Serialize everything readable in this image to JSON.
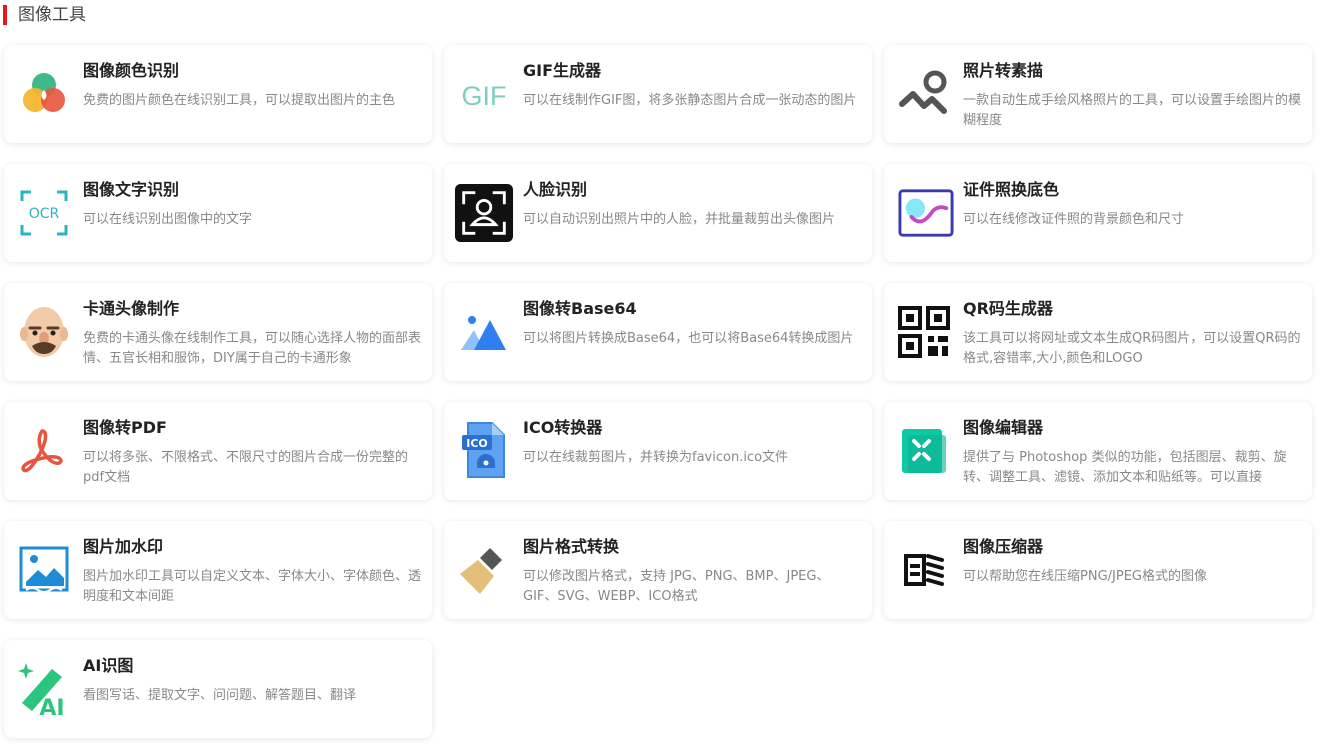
{
  "section": {
    "title": "图像工具",
    "accent_color": "#e01b1b"
  },
  "tools": [
    {
      "icon": "color-picker-icon",
      "title": "图像颜色识别",
      "desc": "免费的图片颜色在线识别工具，可以提取出图片的主色"
    },
    {
      "icon": "gif-icon",
      "title": "GIF生成器",
      "desc": "可以在线制作GIF图，将多张静态图片合成一张动态的图片",
      "icon_text": "GIF"
    },
    {
      "icon": "sketch-icon",
      "title": "照片转素描",
      "desc": "一款自动生成手绘风格照片的工具，可以设置手绘图片的模糊程度"
    },
    {
      "icon": "ocr-icon",
      "title": "图像文字识别",
      "desc": "可以在线识别出图像中的文字",
      "icon_text": "OCR"
    },
    {
      "icon": "face-scan-icon",
      "title": "人脸识别",
      "desc": "可以自动识别出照片中的人脸，并批量裁剪出头像图片"
    },
    {
      "icon": "id-photo-icon",
      "title": "证件照换底色",
      "desc": "可以在线修改证件照的背景颜色和尺寸"
    },
    {
      "icon": "cartoon-face-icon",
      "title": "卡通头像制作",
      "desc": "免费的卡通头像在线制作工具，可以随心选择人物的面部表情、五官长相和服饰，DIY属于自己的卡通形象"
    },
    {
      "icon": "image-mountain-icon",
      "title": "图像转Base64",
      "desc": "可以将图片转换成Base64，也可以将Base64转换成图片"
    },
    {
      "icon": "qr-code-icon",
      "title": "QR码生成器",
      "desc": "该工具可以将网址或文本生成QR码图片，可以设置QR码的格式,容错率,大小,颜色和LOGO"
    },
    {
      "icon": "pdf-icon",
      "title": "图像转PDF",
      "desc": "可以将多张、不限格式、不限尺寸的图片合成一份完整的pdf文档"
    },
    {
      "icon": "ico-file-icon",
      "title": "ICO转换器",
      "desc": "可以在线裁剪图片，并转换为favicon.ico文件",
      "icon_text": "ICO"
    },
    {
      "icon": "image-editor-icon",
      "title": "图像编辑器",
      "desc": "提供了与 Photoshop 类似的功能，包括图层、裁剪、旋转、调整工具、滤镜、添加文本和贴纸等。可以直接"
    },
    {
      "icon": "watermark-icon",
      "title": "图片加水印",
      "desc": "图片加水印工具可以自定义文本、字体大小、字体颜色、透明度和文本间距"
    },
    {
      "icon": "brush-icon",
      "title": "图片格式转换",
      "desc": "可以修改图片格式，支持 JPG、PNG、BMP、JPEG、GIF、SVG、WEBP、ICO格式"
    },
    {
      "icon": "compress-icon",
      "title": "图像压缩器",
      "desc": "可以帮助您在线压缩PNG/JPEG格式的图像"
    },
    {
      "icon": "ai-magic-icon",
      "title": "AI识图",
      "desc": "看图写话、提取文字、问问题、解答题目、翻译",
      "icon_text": "AI"
    }
  ]
}
